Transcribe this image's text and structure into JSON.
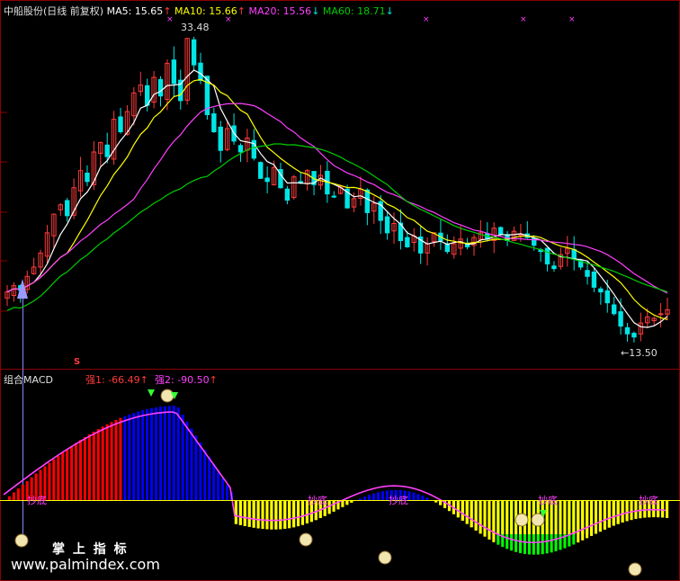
{
  "header": {
    "title": "中船股份(日线 前复权)",
    "ma5_label": "MA5: 15.65",
    "ma10_label": "MA10: 15.66",
    "ma20_label": "MA20: 15.56",
    "ma60_label": "MA60: 18.71",
    "arrow_up": "↑",
    "arrow_down": "↓"
  },
  "annotations": {
    "high_label": "33.48",
    "low_label": "←13.50",
    "s_marker": "S"
  },
  "macd_panel": {
    "title": "组合MACD",
    "strong1": "强1: -66.49",
    "strong2": "强2: -90.50",
    "arrow_up": "↑",
    "bottom_label": "抄底"
  },
  "watermark": {
    "cn": "掌 上 指 标",
    "url": "www.palmindex.com"
  },
  "colors": {
    "up": "#ff3b3b",
    "down": "#00e5e5",
    "ma5": "#ffffff",
    "ma10": "#ffff00",
    "ma20": "#ff40ff",
    "ma60": "#00cc00",
    "macd_red": "#ff0000",
    "macd_blue": "#0000ff",
    "macd_yellow": "#ffff00",
    "macd_green": "#00ff00"
  },
  "chart_data": {
    "type": "candlestick",
    "price_range": [
      13.5,
      33.48
    ],
    "ma5": 15.65,
    "ma10": 15.66,
    "ma20": 15.56,
    "ma60": 18.71,
    "close": [
      16.8,
      17.2,
      16.9,
      17.8,
      18.4,
      19.3,
      20.6,
      21.8,
      22.4,
      21.7,
      23.5,
      24.6,
      23.9,
      25.8,
      26.4,
      25.5,
      27.9,
      27.1,
      28.4,
      29.6,
      30.1,
      28.8,
      30.6,
      29.4,
      31.5,
      30.2,
      29.1,
      33.1,
      31.4,
      30.4,
      28.2,
      27.1,
      25.9,
      27.3,
      26.5,
      25.8,
      26.7,
      25.4,
      24.1,
      23.9,
      24.8,
      23.5,
      22.7,
      24.2,
      23.8,
      24.6,
      23.7,
      24.3,
      23.1,
      22.9,
      23.6,
      22.2,
      22.8,
      23.4,
      21.9,
      22.5,
      21.4,
      20.6,
      21.2,
      20.1,
      19.7,
      20.4,
      19.3,
      19.9,
      20.6,
      20.1,
      19.4,
      19.9,
      20.2,
      19.7,
      20.3,
      20.6,
      20.2,
      20.9,
      20.5,
      20.1,
      20.7,
      20.5,
      20.3,
      19.8,
      19.4,
      18.6,
      18.3,
      19.2,
      19.6,
      18.9,
      18.4,
      17.8,
      17.1,
      16.8,
      16.1,
      15.4,
      14.6,
      14.1,
      13.9,
      14.8,
      15.2,
      15.1,
      15.4,
      15.65
    ]
  }
}
